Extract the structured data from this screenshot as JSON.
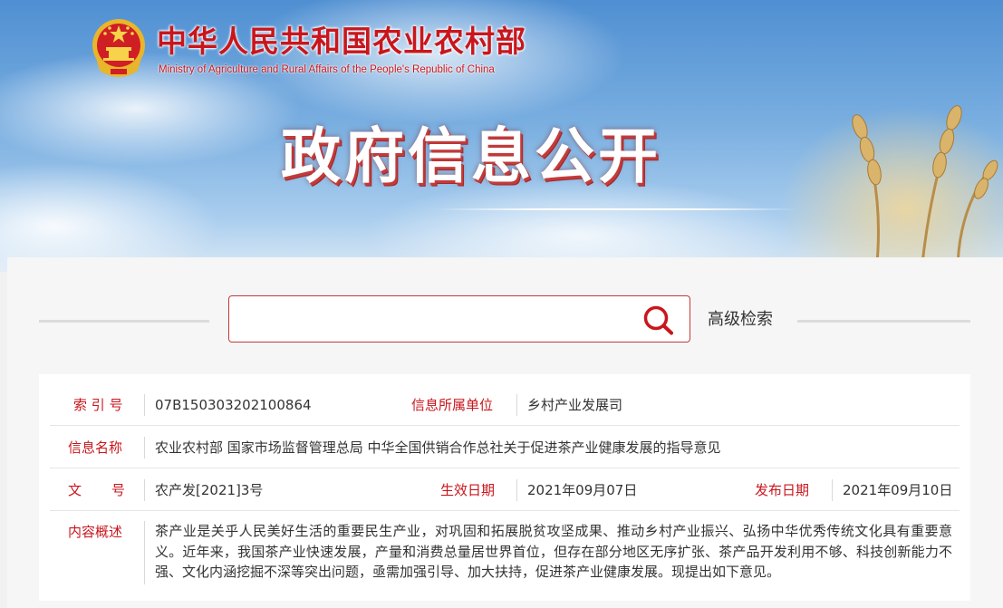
{
  "header": {
    "ministry_cn": "中华人民共和国农业农村部",
    "ministry_en": "Ministry of Agriculture and Rural Affairs of the People's Republic of China",
    "emblem_icon": "national-emblem-icon",
    "page_heading": "政府信息公开"
  },
  "search": {
    "placeholder": "",
    "value": "",
    "icon": "search-icon",
    "advanced_label": "高级检索"
  },
  "info": {
    "index_label": "索 引 号",
    "index_value": "07B150303202100864",
    "unit_label": "信息所属单位",
    "unit_value": "乡村产业发展司",
    "name_label": "信息名称",
    "name_value": "农业农村部 国家市场监督管理总局 中华全国供销合作总社关于促进茶产业健康发展的指导意见",
    "doc_no_label_1": "文",
    "doc_no_label_2": "号",
    "doc_no_value": "农产发[2021]3号",
    "effective_label": "生效日期",
    "effective_value": "2021年09月07日",
    "published_label": "发布日期",
    "published_value": "2021年09月10日",
    "summary_label": "内容概述",
    "summary_value": "茶产业是关乎人民美好生活的重要民生产业，对巩固和拓展脱贫攻坚成果、推动乡村产业振兴、弘扬中华优秀传统文化具有重要意义。近年来，我国茶产业快速发展，产量和消费总量居世界首位，但存在部分地区无序扩张、茶产品开发利用不够、科技创新能力不强、文化内涵挖掘不深等突出问题，亟需加强引导、加大扶持，促进茶产业健康发展。现提出如下意见。"
  },
  "colors": {
    "brand_red": "#c8161d",
    "label_red": "#c8161d",
    "text": "#333333"
  }
}
